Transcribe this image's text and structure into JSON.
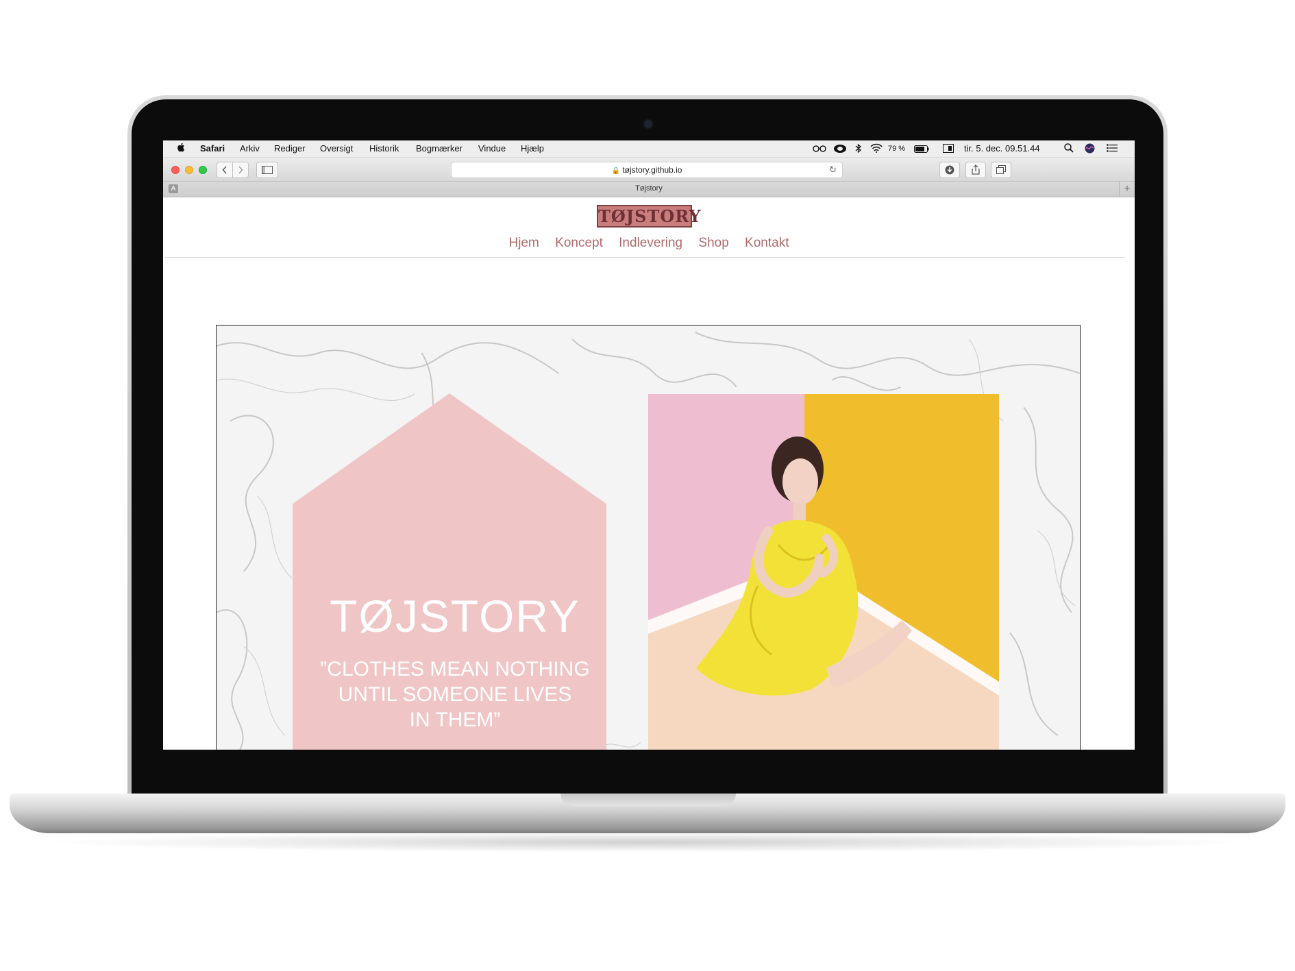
{
  "menubar": {
    "apple": "",
    "app": "Safari",
    "menus": [
      "Arkiv",
      "Rediger",
      "Oversigt",
      "Historik",
      "Bogmærker",
      "Vindue",
      "Hjælp"
    ],
    "battery": "79 %",
    "datetime": "tir. 5. dec.  09.51.44"
  },
  "browser": {
    "url": "tøjstory.github.io",
    "tab_title": "Tøjstory",
    "tab_badge": "A"
  },
  "site": {
    "logo": "TØJSTORY",
    "nav": [
      "Hjem",
      "Koncept",
      "Indlevering",
      "Shop",
      "Kontakt"
    ],
    "hero_title": "TØJSTORY",
    "hero_quote": [
      "”CLOTHES MEAN NOTHING",
      "UNTIL SOMEONE LIVES",
      "IN THEM”"
    ]
  },
  "colors": {
    "accent": "#b06a6a",
    "logo_bg": "#c97d7d",
    "house_pink": "#f0c5c5",
    "photo_yellow": "#f0bd2c",
    "photo_pink": "#efb8c5"
  }
}
